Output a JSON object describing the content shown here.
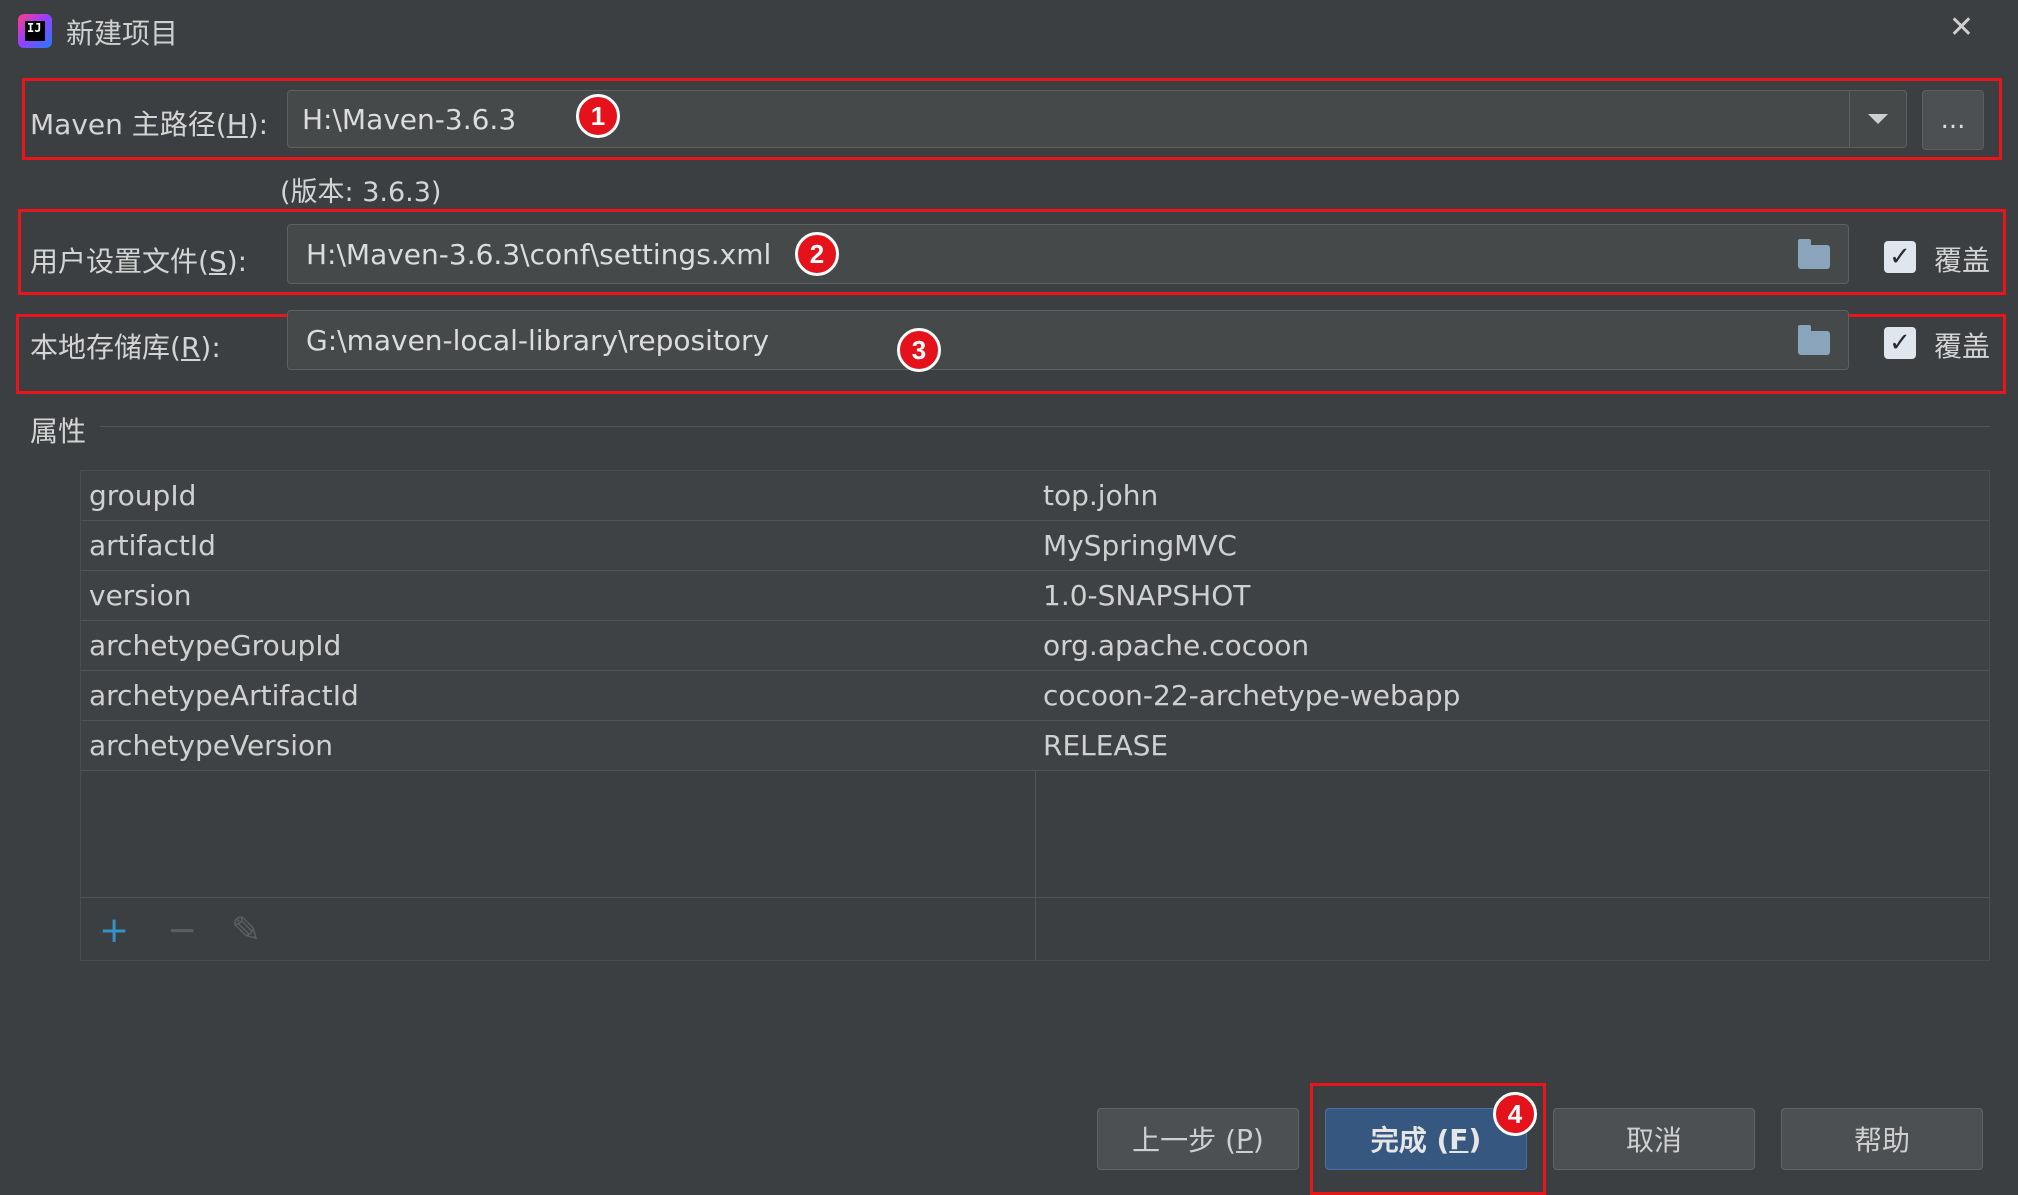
{
  "window": {
    "title": "新建项目"
  },
  "maven_home": {
    "label": "Maven 主路径(",
    "mnemonic": "H",
    "label_end": "):",
    "value": "H:\\Maven-3.6.3",
    "version_text": "(版本: 3.6.3)",
    "browse_label": "..."
  },
  "user_settings": {
    "label": "用户设置文件(",
    "mnemonic": "S",
    "label_end": "):",
    "value": "H:\\Maven-3.6.3\\conf\\settings.xml",
    "override_label": "覆盖",
    "override_checked": true
  },
  "local_repo": {
    "label": "本地存储库(",
    "mnemonic": "R",
    "label_end": "):",
    "value": "G:\\maven-local-library\\repository",
    "override_label": "覆盖",
    "override_checked": true
  },
  "properties": {
    "section_title": "属性",
    "rows": [
      {
        "key": "groupId",
        "value": "top.john"
      },
      {
        "key": "artifactId",
        "value": "MySpringMVC"
      },
      {
        "key": "version",
        "value": "1.0-SNAPSHOT"
      },
      {
        "key": "archetypeGroupId",
        "value": "org.apache.cocoon"
      },
      {
        "key": "archetypeArtifactId",
        "value": "cocoon-22-archetype-webapp"
      },
      {
        "key": "archetypeVersion",
        "value": "RELEASE"
      }
    ],
    "toolbar": {
      "add": "+",
      "remove": "−",
      "edit": "✎"
    }
  },
  "footer": {
    "prev": {
      "label": "上一步 (",
      "mnemonic": "P",
      "end": ")"
    },
    "finish": {
      "label": "完成 (",
      "mnemonic": "F",
      "end": ")"
    },
    "cancel": "取消",
    "help": "帮助"
  },
  "annotations": [
    "1",
    "2",
    "3",
    "4"
  ],
  "colors": {
    "accent_red": "#e8161b",
    "primary_button": "#365880",
    "add_icon": "#3592c4"
  }
}
